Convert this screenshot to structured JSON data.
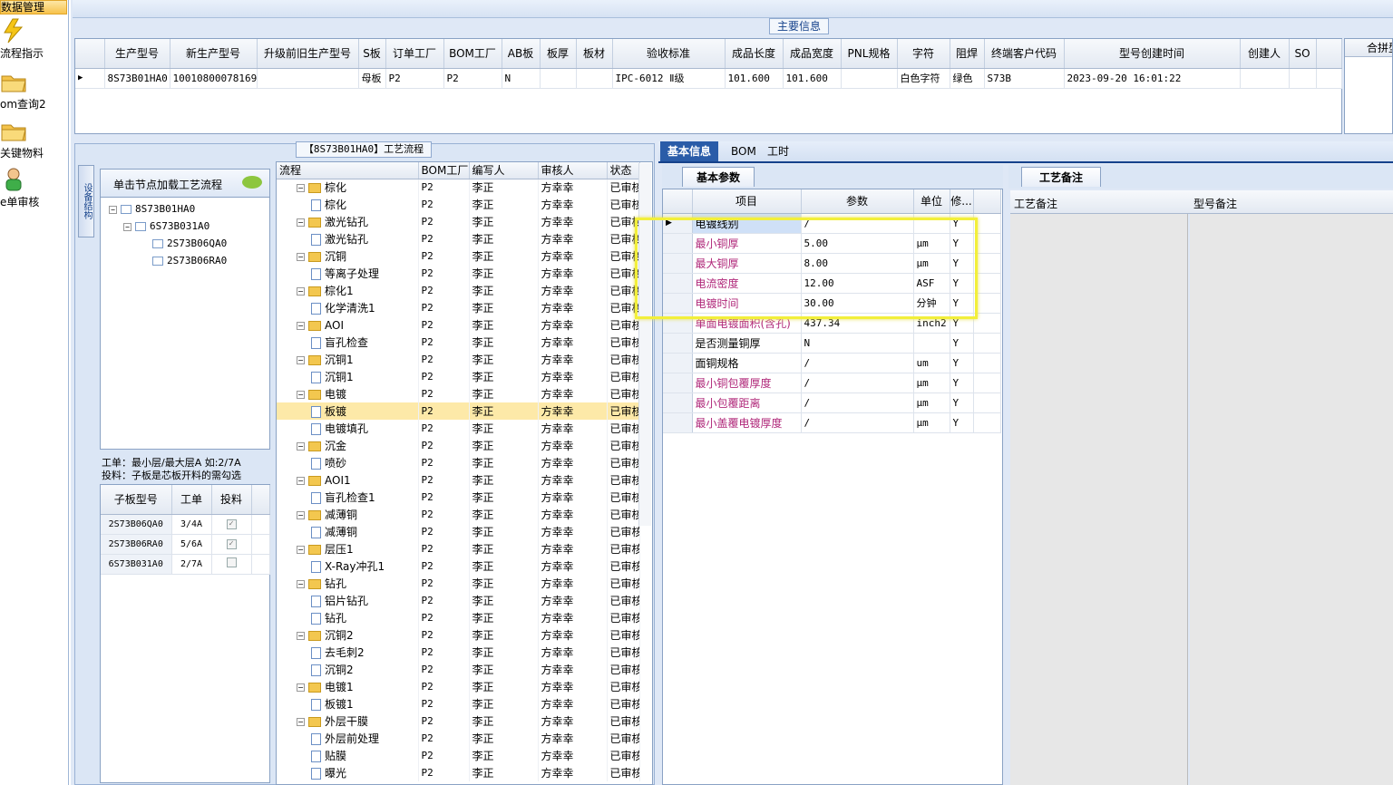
{
  "leftnav": {
    "header": "数据管理",
    "items": [
      {
        "label": "流程指示",
        "icon": "lightning-icon"
      },
      {
        "label": "om查询2",
        "icon": "folder-icon"
      },
      {
        "label": "关键物料",
        "icon": "folder-icon"
      },
      {
        "label": "e单审核",
        "icon": "user-icon"
      }
    ]
  },
  "main_info": {
    "tab": "主要信息",
    "headers": [
      "生产型号",
      "新生产型号",
      "升级前旧生产型号",
      "S板",
      "订单工厂",
      "BOM工厂",
      "AB板",
      "板厚",
      "板材",
      "验收标准",
      "成品长度",
      "成品宽度",
      "PNL规格",
      "字符",
      "阻焊",
      "终端客户代码",
      "型号创建时间",
      "创建人",
      "SO"
    ],
    "row": [
      "8S73B01HA0",
      "10010800078169",
      "",
      "母板",
      "P2",
      "P2",
      "N",
      "",
      "",
      "IPC-6012 Ⅱ级",
      "101.600",
      "101.600",
      "",
      "白色字符",
      "绿色",
      "S73B",
      "2023-09-20 16:01:22",
      "",
      ""
    ],
    "right_header": "合拼型"
  },
  "process": {
    "tab": "【8S73B01HA0】工艺流程",
    "struct_tab": "设备结构",
    "struct_head": "单击节点加载工艺流程",
    "tree": [
      "8S73B01HA0",
      "6S73B031A0",
      "2S73B06QA0",
      "2S73B06RA0"
    ],
    "info_line1": "工单：最小层/最大层A 如:2/7A",
    "info_line2": "投料：子板是芯板开料的需勾选",
    "sub_headers": [
      "子板型号",
      "工单",
      "投料"
    ],
    "sub_rows": [
      {
        "model": "2S73B06QA0",
        "order": "3/4A",
        "checked": true
      },
      {
        "model": "2S73B06RA0",
        "order": "5/6A",
        "checked": true
      },
      {
        "model": "6S73B031A0",
        "order": "2/7A",
        "checked": false
      }
    ],
    "headers": [
      "流程",
      "BOM工厂",
      "编写人",
      "审核人",
      "状态"
    ],
    "rows": [
      {
        "name": "棕化",
        "level": 0,
        "factory": "P2",
        "writer": "李正",
        "reviewer": "方幸幸",
        "status": "已审核"
      },
      {
        "name": "棕化",
        "level": 1,
        "factory": "P2",
        "writer": "李正",
        "reviewer": "方幸幸",
        "status": "已审核"
      },
      {
        "name": "激光钻孔",
        "level": 0,
        "factory": "P2",
        "writer": "李正",
        "reviewer": "方幸幸",
        "status": "已审核"
      },
      {
        "name": "激光钻孔",
        "level": 1,
        "factory": "P2",
        "writer": "李正",
        "reviewer": "方幸幸",
        "status": "已审核"
      },
      {
        "name": "沉铜",
        "level": 0,
        "factory": "P2",
        "writer": "李正",
        "reviewer": "方幸幸",
        "status": "已审核"
      },
      {
        "name": "等离子处理",
        "level": 1,
        "factory": "P2",
        "writer": "李正",
        "reviewer": "方幸幸",
        "status": "已审核"
      },
      {
        "name": "棕化1",
        "level": 0,
        "factory": "P2",
        "writer": "李正",
        "reviewer": "方幸幸",
        "status": "已审核"
      },
      {
        "name": "化学清洗1",
        "level": 1,
        "factory": "P2",
        "writer": "李正",
        "reviewer": "方幸幸",
        "status": "已审核"
      },
      {
        "name": "AOI",
        "level": 0,
        "factory": "P2",
        "writer": "李正",
        "reviewer": "方幸幸",
        "status": "已审核"
      },
      {
        "name": "盲孔检查",
        "level": 1,
        "factory": "P2",
        "writer": "李正",
        "reviewer": "方幸幸",
        "status": "已审核"
      },
      {
        "name": "沉铜1",
        "level": 0,
        "factory": "P2",
        "writer": "李正",
        "reviewer": "方幸幸",
        "status": "已审核"
      },
      {
        "name": "沉铜1",
        "level": 1,
        "factory": "P2",
        "writer": "李正",
        "reviewer": "方幸幸",
        "status": "已审核"
      },
      {
        "name": "电镀",
        "level": 0,
        "factory": "P2",
        "writer": "李正",
        "reviewer": "方幸幸",
        "status": "已审核"
      },
      {
        "name": "板镀",
        "level": 1,
        "factory": "P2",
        "writer": "李正",
        "reviewer": "方幸幸",
        "status": "已审核",
        "selected": true
      },
      {
        "name": "电镀填孔",
        "level": 1,
        "factory": "P2",
        "writer": "李正",
        "reviewer": "方幸幸",
        "status": "已审核"
      },
      {
        "name": "沉金",
        "level": 0,
        "factory": "P2",
        "writer": "李正",
        "reviewer": "方幸幸",
        "status": "已审核"
      },
      {
        "name": "喷砂",
        "level": 1,
        "factory": "P2",
        "writer": "李正",
        "reviewer": "方幸幸",
        "status": "已审核"
      },
      {
        "name": "AOI1",
        "level": 0,
        "factory": "P2",
        "writer": "李正",
        "reviewer": "方幸幸",
        "status": "已审核"
      },
      {
        "name": "盲孔检查1",
        "level": 1,
        "factory": "P2",
        "writer": "李正",
        "reviewer": "方幸幸",
        "status": "已审核"
      },
      {
        "name": "减薄铜",
        "level": 0,
        "factory": "P2",
        "writer": "李正",
        "reviewer": "方幸幸",
        "status": "已审核"
      },
      {
        "name": "减薄铜",
        "level": 1,
        "factory": "P2",
        "writer": "李正",
        "reviewer": "方幸幸",
        "status": "已审核"
      },
      {
        "name": "层压1",
        "level": 0,
        "factory": "P2",
        "writer": "李正",
        "reviewer": "方幸幸",
        "status": "已审核"
      },
      {
        "name": "X-Ray冲孔1",
        "level": 1,
        "factory": "P2",
        "writer": "李正",
        "reviewer": "方幸幸",
        "status": "已审核"
      },
      {
        "name": "钻孔",
        "level": 0,
        "factory": "P2",
        "writer": "李正",
        "reviewer": "方幸幸",
        "status": "已审核"
      },
      {
        "name": "铝片钻孔",
        "level": 1,
        "factory": "P2",
        "writer": "李正",
        "reviewer": "方幸幸",
        "status": "已审核"
      },
      {
        "name": "钻孔",
        "level": 1,
        "factory": "P2",
        "writer": "李正",
        "reviewer": "方幸幸",
        "status": "已审核"
      },
      {
        "name": "沉铜2",
        "level": 0,
        "factory": "P2",
        "writer": "李正",
        "reviewer": "方幸幸",
        "status": "已审核"
      },
      {
        "name": "去毛刺2",
        "level": 1,
        "factory": "P2",
        "writer": "李正",
        "reviewer": "方幸幸",
        "status": "已审核"
      },
      {
        "name": "沉铜2",
        "level": 1,
        "factory": "P2",
        "writer": "李正",
        "reviewer": "方幸幸",
        "status": "已审核"
      },
      {
        "name": "电镀1",
        "level": 0,
        "factory": "P2",
        "writer": "李正",
        "reviewer": "方幸幸",
        "status": "已审核"
      },
      {
        "name": "板镀1",
        "level": 1,
        "factory": "P2",
        "writer": "李正",
        "reviewer": "方幸幸",
        "status": "已审核"
      },
      {
        "name": "外层干膜",
        "level": 0,
        "factory": "P2",
        "writer": "李正",
        "reviewer": "方幸幸",
        "status": "已审核"
      },
      {
        "name": "外层前处理",
        "level": 1,
        "factory": "P2",
        "writer": "李正",
        "reviewer": "方幸幸",
        "status": "已审核"
      },
      {
        "name": "贴膜",
        "level": 1,
        "factory": "P2",
        "writer": "李正",
        "reviewer": "方幸幸",
        "status": "已审核"
      },
      {
        "name": "曝光",
        "level": 1,
        "factory": "P2",
        "writer": "李正",
        "reviewer": "方幸幸",
        "status": "已审核"
      }
    ]
  },
  "right": {
    "tabs": [
      "基本信息",
      "BOM",
      "工时"
    ],
    "basic_tab": "基本参数",
    "headers": [
      "项目",
      "参数",
      "单位",
      "修..."
    ],
    "rows": [
      {
        "item": "电镀线别",
        "value": "/",
        "unit": "",
        "flag": "Y",
        "pink": false,
        "selected": true
      },
      {
        "item": "最小铜厚",
        "value": "5.00",
        "unit": "μm",
        "flag": "Y",
        "pink": true
      },
      {
        "item": "最大铜厚",
        "value": "8.00",
        "unit": "μm",
        "flag": "Y",
        "pink": true
      },
      {
        "item": "电流密度",
        "value": "12.00",
        "unit": "ASF",
        "flag": "Y",
        "pink": true
      },
      {
        "item": "电镀时间",
        "value": "30.00",
        "unit": "分钟",
        "flag": "Y",
        "pink": true
      },
      {
        "item": "单面电镀面积(含孔)",
        "value": "437.34",
        "unit": "inch2",
        "flag": "Y",
        "pink": true
      },
      {
        "item": "是否测量铜厚",
        "value": "N",
        "unit": "",
        "flag": "Y",
        "pink": false
      },
      {
        "item": "面铜规格",
        "value": "/",
        "unit": "um",
        "flag": "Y",
        "pink": false
      },
      {
        "item": "最小铜包覆厚度",
        "value": "/",
        "unit": "μm",
        "flag": "Y",
        "pink": true
      },
      {
        "item": "最小包覆距离",
        "value": "/",
        "unit": "μm",
        "flag": "Y",
        "pink": true
      },
      {
        "item": "最小盖覆电镀厚度",
        "value": "/",
        "unit": "μm",
        "flag": "Y",
        "pink": true
      }
    ],
    "notes_tab": "工艺备注",
    "notes_cols": [
      "工艺备注",
      "型号备注"
    ]
  },
  "colors": {
    "accent": "#15428b",
    "pink_label": "#b0287a",
    "highlight": "#f2ef3b",
    "selected_row": "#fde9a8"
  }
}
